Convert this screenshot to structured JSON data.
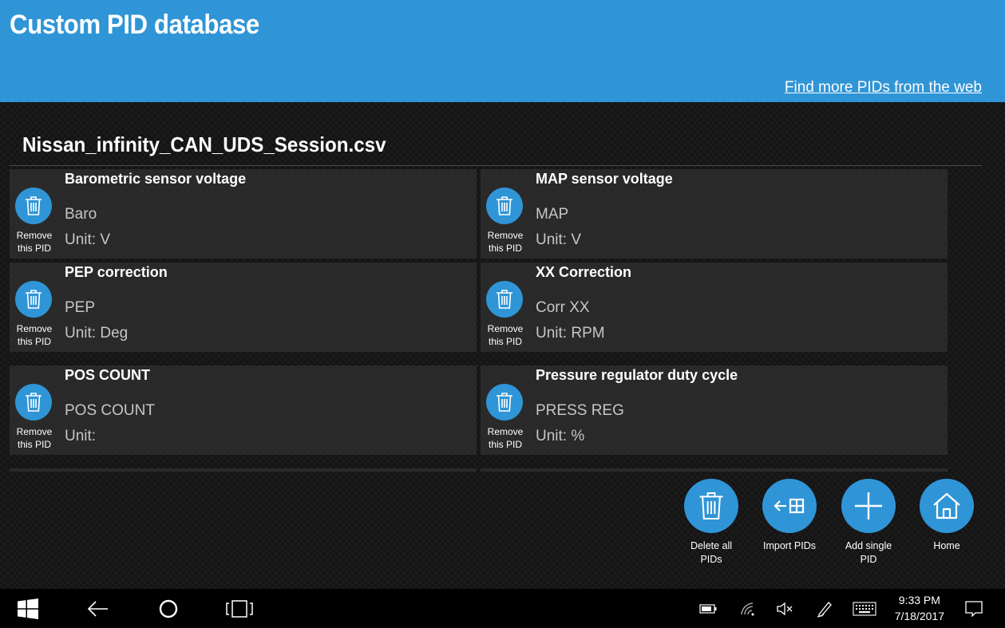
{
  "header": {
    "title": "Custom PID database",
    "web_link": "Find more PIDs from the web"
  },
  "file": {
    "name": "Nissan_infinity_CAN_UDS_Session.csv"
  },
  "remove_label_line1": "Remove",
  "remove_label_line2": "this PID",
  "pids": [
    {
      "name": "Barometric sensor voltage",
      "short": "Baro",
      "unit": "Unit: V"
    },
    {
      "name": "MAP sensor voltage",
      "short": "MAP",
      "unit": "Unit: V"
    },
    {
      "name": "PEP correction",
      "short": "PEP",
      "unit": "Unit: Deg"
    },
    {
      "name": "XX Correction",
      "short": "Corr XX",
      "unit": "Unit: RPM"
    },
    {
      "name": "POS COUNT",
      "short": "POS COUNT",
      "unit": "Unit:"
    },
    {
      "name": "Pressure regulator duty cycle",
      "short": "PRESS REG",
      "unit": "Unit: %"
    }
  ],
  "actions": {
    "delete_all": {
      "line1": "Delete all",
      "line2": "PIDs",
      "icon": "trash-icon"
    },
    "import": {
      "line1": "Import PIDs",
      "line2": "",
      "icon": "import-icon"
    },
    "add_single": {
      "line1": "Add single",
      "line2": "PID",
      "icon": "plus-icon"
    },
    "home": {
      "line1": "Home",
      "line2": "",
      "icon": "home-icon"
    }
  },
  "taskbar": {
    "time": "9:33 PM",
    "date": "7/18/2017"
  },
  "colors": {
    "accent": "#2f95d6",
    "card": "#2c2c2c",
    "taskbar": "#000000"
  }
}
